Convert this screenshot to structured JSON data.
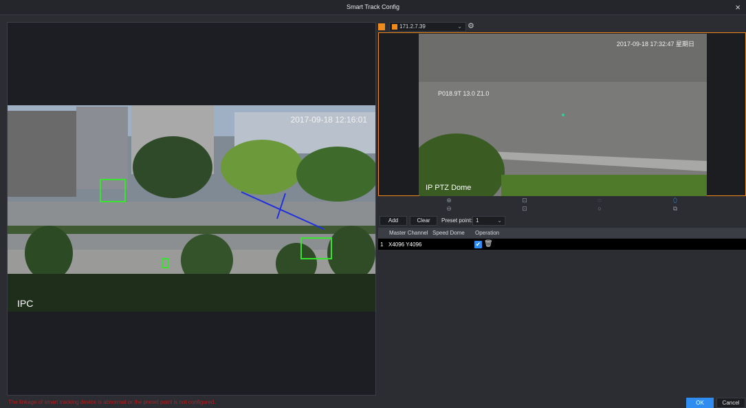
{
  "window": {
    "title": "Smart Track Config",
    "close_symbol": "×"
  },
  "ipc": {
    "label": "IPC",
    "timestamp": "2017-09-18 12:16:01"
  },
  "ptz": {
    "ip": "171.2.7.39",
    "label": "IP PTZ Dome",
    "timestamp": "2017-09-18 17:32:47 星期日",
    "position_text": "P018.9T 13.0 Z1.0"
  },
  "toolbar": {
    "add_label": "Add",
    "clear_label": "Clear",
    "preset_label": "Preset point:",
    "preset_value": "1"
  },
  "table": {
    "headers": [
      "Master Channel",
      "Speed Dome",
      "Operation"
    ],
    "rows": [
      {
        "index": "1",
        "coords": "X4096 Y4096"
      }
    ]
  },
  "footer": {
    "status": "The linkage of smart tracking device is abnormal or the preset point is not configured.",
    "ok_label": "OK",
    "cancel_label": "Cancel"
  },
  "colors": {
    "accent": "#2f8cf0",
    "orange": "#f08a1c",
    "error": "#b51e1e"
  }
}
